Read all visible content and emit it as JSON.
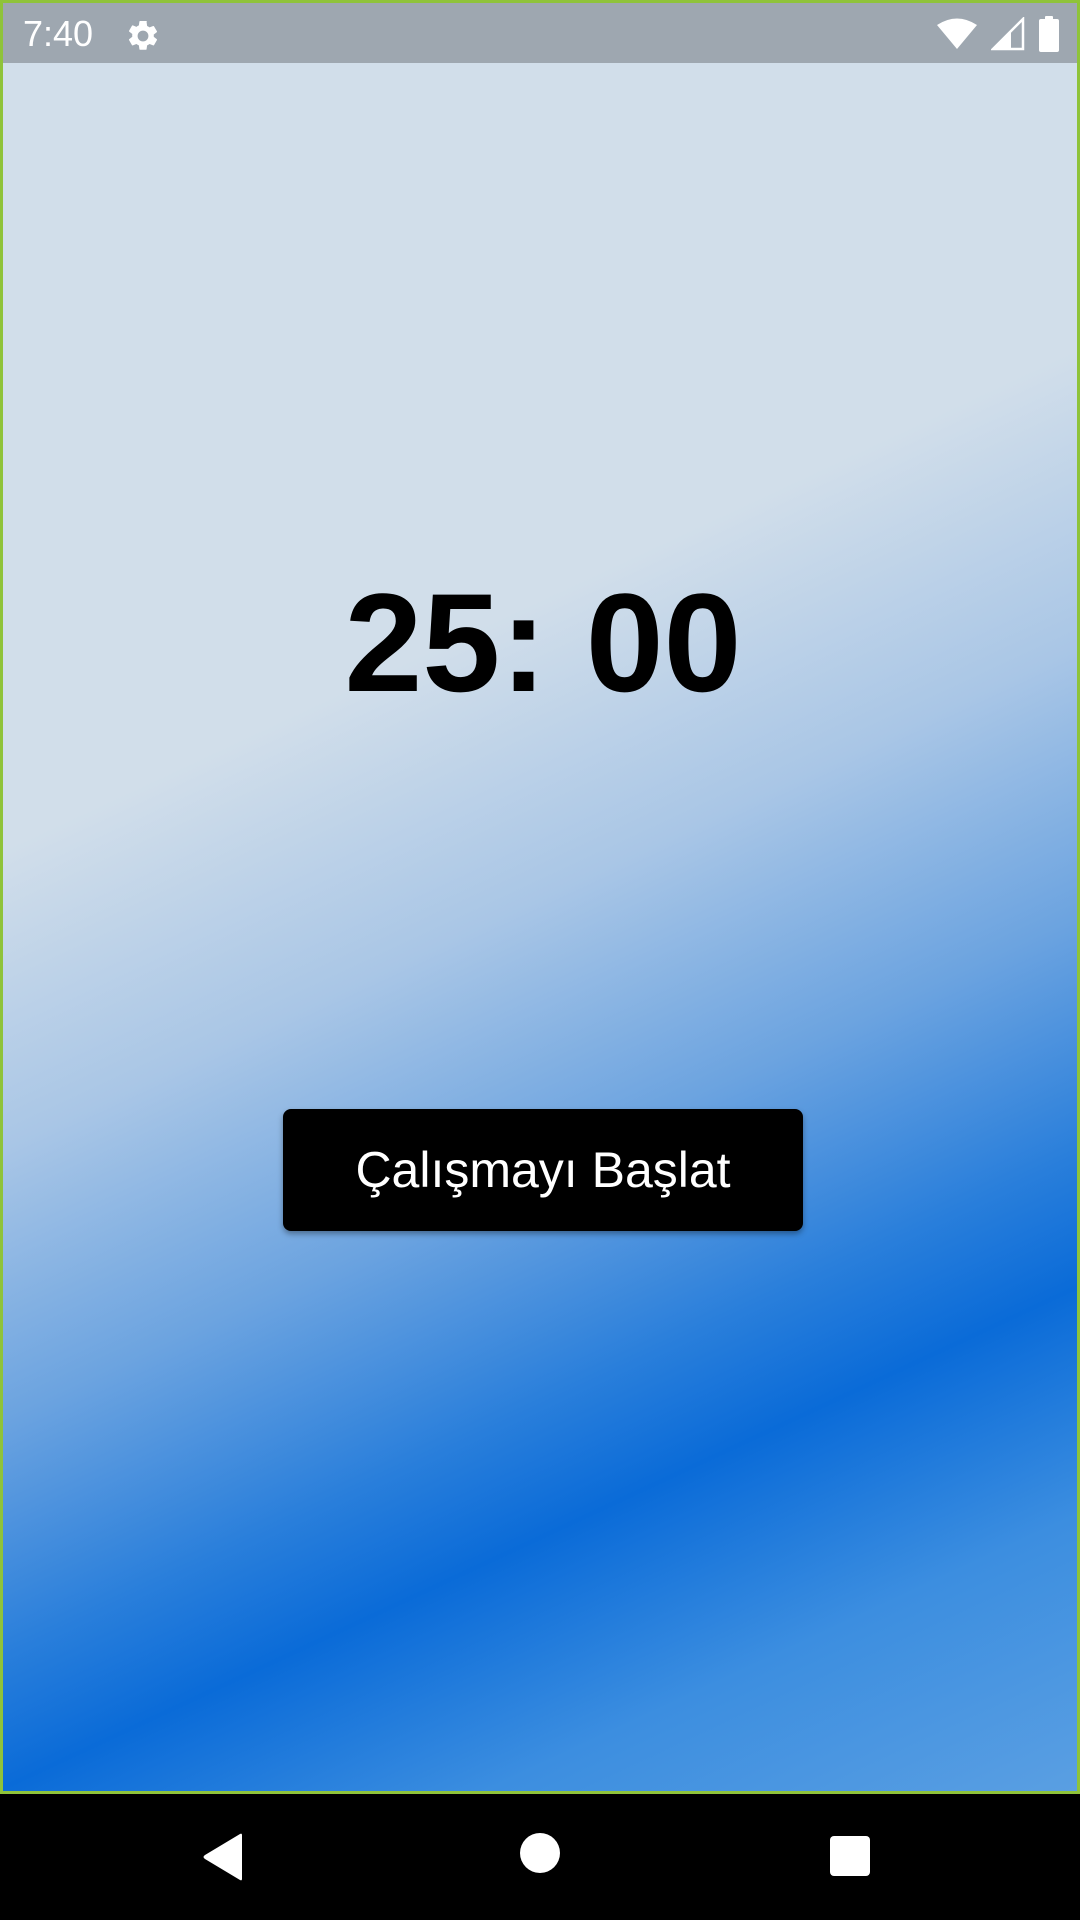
{
  "status_bar": {
    "time": "7:40",
    "icons": [
      "settings-gear-icon",
      "wifi-icon",
      "cell-signal-icon",
      "battery-icon"
    ],
    "background": "#9ea7b0"
  },
  "timer": {
    "display": "25: 00"
  },
  "start_button": {
    "label": "Çalışmayı Başlat",
    "background": "#000000",
    "text_color": "#ffffff"
  },
  "nav_bar": {
    "buttons": [
      "back-icon",
      "home-icon",
      "recent-apps-icon"
    ]
  },
  "colors": {
    "gradient_top": "#d1deea",
    "gradient_bottom": "#0a6bd8",
    "frame_border": "#8fc33a"
  }
}
